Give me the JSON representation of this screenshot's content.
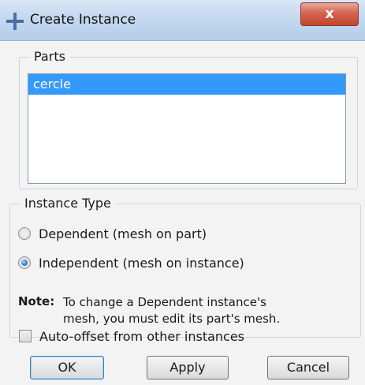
{
  "window": {
    "title": "Create Instance",
    "close_label": "x"
  },
  "parts": {
    "label": "Parts",
    "items": [
      "cercle"
    ],
    "selected_index": 0
  },
  "instance_type": {
    "label": "Instance Type",
    "options": [
      {
        "label": "Dependent (mesh on part)",
        "checked": false
      },
      {
        "label": "Independent (mesh on instance)",
        "checked": true
      }
    ],
    "note_label": "Note:",
    "note_line1": "To change a Dependent instance's",
    "note_line2": "mesh, you must edit its part's mesh."
  },
  "auto_offset": {
    "label": "Auto-offset from other instances",
    "checked": false
  },
  "buttons": {
    "ok": "OK",
    "apply": "Apply",
    "cancel": "Cancel"
  },
  "colors": {
    "selection": "#3399ff",
    "titlebar": "#c4d8ef",
    "close_button": "#c2452f"
  }
}
